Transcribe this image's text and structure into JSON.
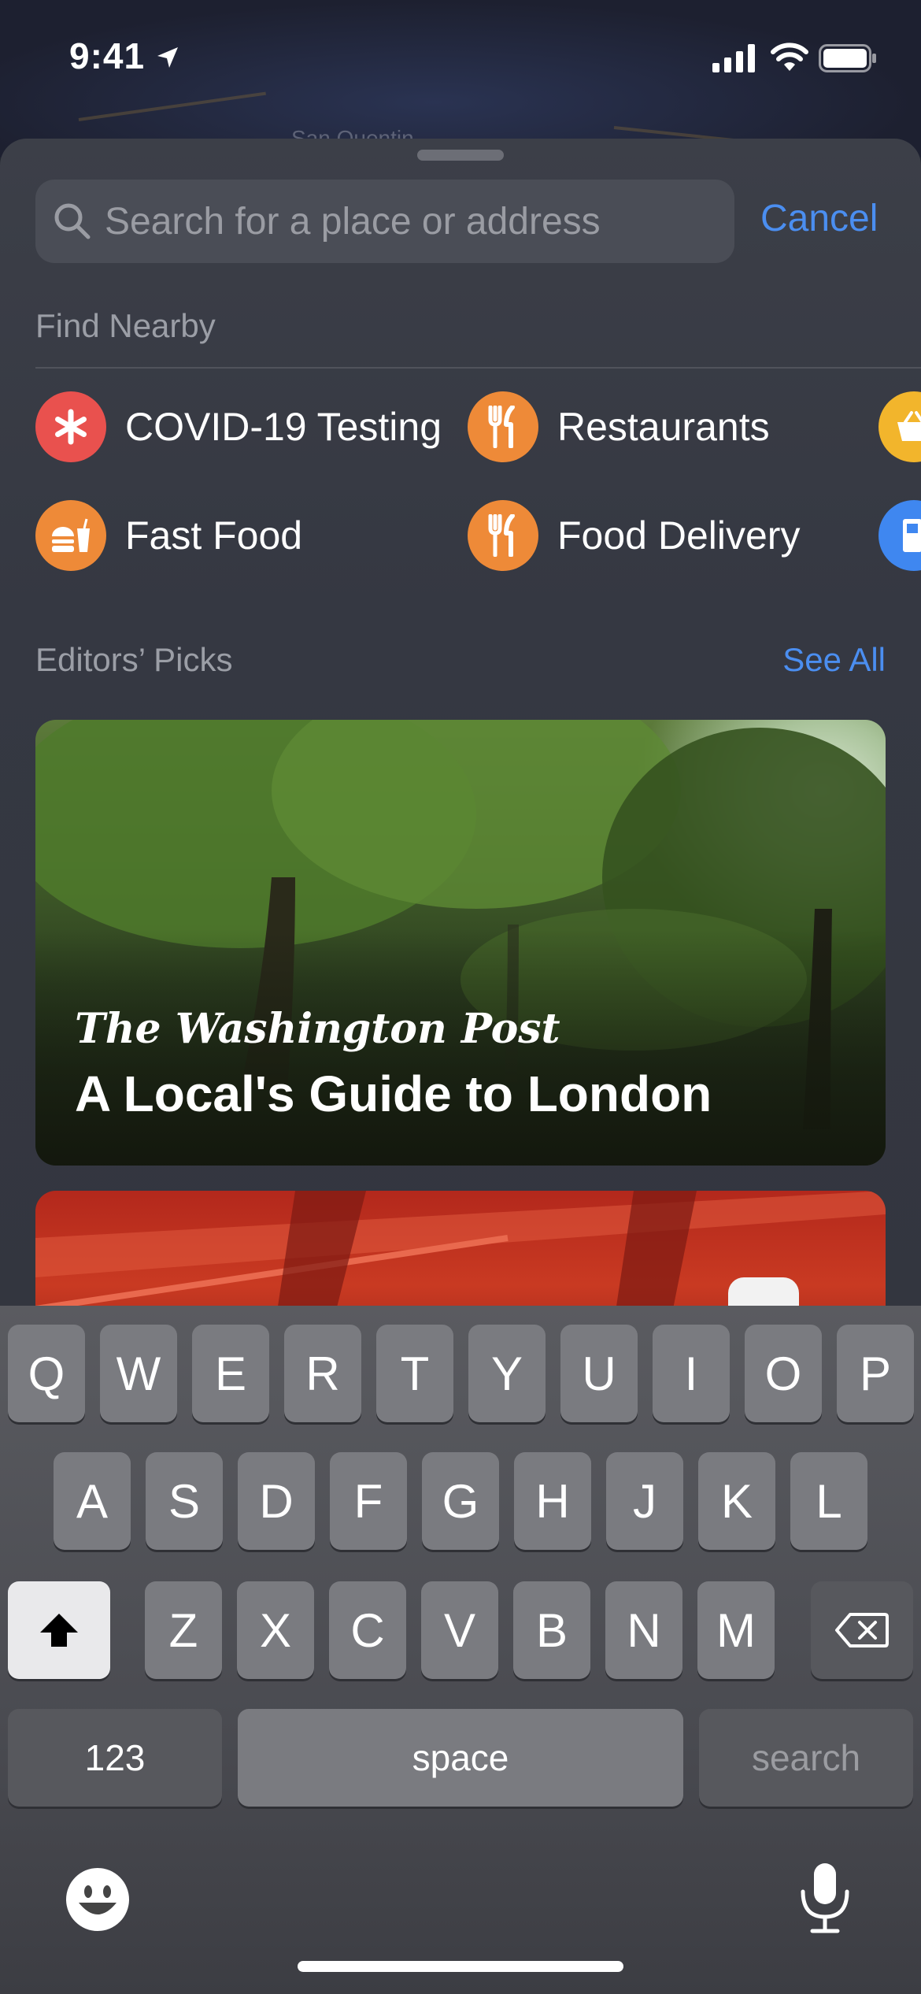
{
  "status_bar": {
    "time": "9:41"
  },
  "map": {
    "label": "San Quentin"
  },
  "search": {
    "placeholder": "Search for a place or address",
    "cancel_label": "Cancel"
  },
  "find_nearby": {
    "title": "Find Nearby",
    "items": [
      {
        "label": "COVID-19 Testing",
        "icon": "asterisk-icon",
        "color": "#e9514e"
      },
      {
        "label": "Restaurants",
        "icon": "fork-knife-icon",
        "color": "#ee8a38"
      },
      {
        "label": "Fast Food",
        "icon": "burger-drink-icon",
        "color": "#ee8a38"
      },
      {
        "label": "Food Delivery",
        "icon": "fork-knife-icon",
        "color": "#ee8a38"
      }
    ],
    "partial_items": [
      {
        "icon": "basket-icon",
        "color": "#f2b52c"
      },
      {
        "icon": "gas-pump-icon",
        "color": "#3f87f0"
      }
    ]
  },
  "editors_picks": {
    "title": "Editors’ Picks",
    "see_all_label": "See All",
    "cards": [
      {
        "publisher": "The Washington Post",
        "title": "A Local's Guide to London"
      }
    ]
  },
  "keyboard": {
    "row1": [
      "Q",
      "W",
      "E",
      "R",
      "T",
      "Y",
      "U",
      "I",
      "O",
      "P"
    ],
    "row2": [
      "A",
      "S",
      "D",
      "F",
      "G",
      "H",
      "J",
      "K",
      "L"
    ],
    "row3": [
      "Z",
      "X",
      "C",
      "V",
      "B",
      "N",
      "M"
    ],
    "numbers_label": "123",
    "space_label": "space",
    "search_label": "search"
  },
  "colors": {
    "accent": "#4b8ef0",
    "background": "#2d303a"
  }
}
